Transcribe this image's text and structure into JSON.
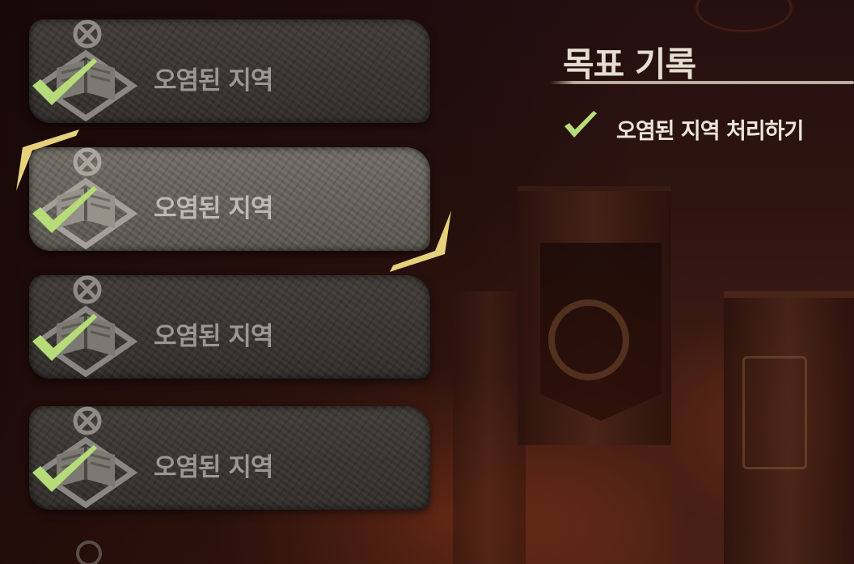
{
  "quest_list": {
    "items": [
      {
        "title": "오염된 지역",
        "status": "completed",
        "selected": false
      },
      {
        "title": "오염된 지역",
        "status": "completed",
        "selected": true
      },
      {
        "title": "오염된 지역",
        "status": "completed",
        "selected": false
      },
      {
        "title": "오염된 지역",
        "status": "completed",
        "selected": false
      }
    ]
  },
  "objectives": {
    "heading": "목표 기록",
    "items": [
      {
        "text": "오염된 지역 처리하기",
        "completed": true
      }
    ]
  },
  "colors": {
    "check_green": "#b5dc78",
    "selection_bracket": "#e6d27a",
    "heading_text": "#e4ddd0",
    "card_text": "#9a9894"
  },
  "icons": {
    "quest_type": "book-journal-icon",
    "quest_state": "crossed-circle-icon",
    "completed": "checkmark-icon"
  }
}
